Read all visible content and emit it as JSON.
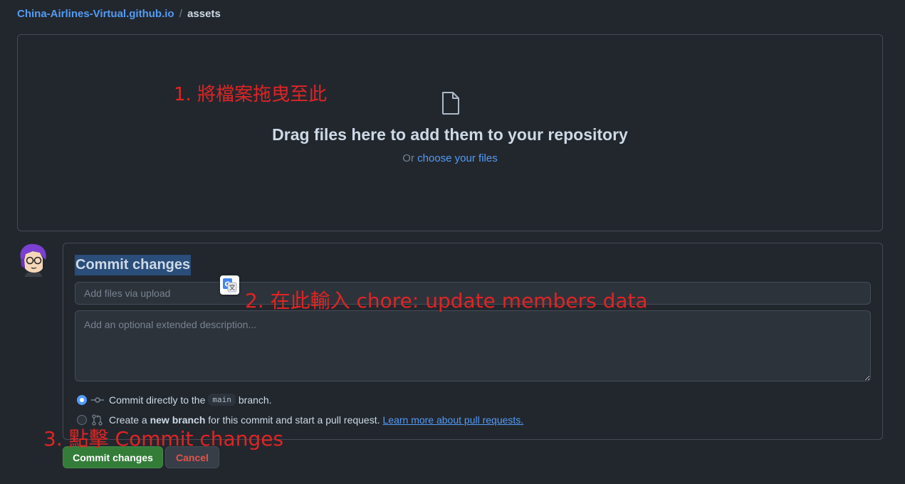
{
  "breadcrumb": {
    "repo": "China-Airlines-Virtual.github.io",
    "separator": "/",
    "folder": "assets"
  },
  "dropzone": {
    "icon": "file-icon",
    "title": "Drag files here to add them to your repository",
    "or_text": "Or",
    "choose_link": "choose your files"
  },
  "commit": {
    "title": "Commit changes",
    "summary_placeholder": "Add files via upload",
    "description_placeholder": "Add an optional extended description...",
    "option_direct": {
      "prefix": "Commit directly to the",
      "branch": "main",
      "suffix": "branch.",
      "selected": true
    },
    "option_new_branch": {
      "prefix": "Create a",
      "bold": "new branch",
      "suffix": "for this commit and start a pull request.",
      "link": "Learn more about pull requests.",
      "selected": false
    }
  },
  "buttons": {
    "commit": "Commit changes",
    "cancel": "Cancel"
  },
  "annotations": {
    "step1": "1. 將檔案拖曳至此",
    "step2": "2. 在此輸入 chore: update members data",
    "step3": "3. 點擊 Commit changes"
  },
  "colors": {
    "background": "#22272e",
    "accent": "#539bf5",
    "commit_button": "#347d39",
    "cancel_text": "#e5534b",
    "annotation": "#e02424"
  }
}
